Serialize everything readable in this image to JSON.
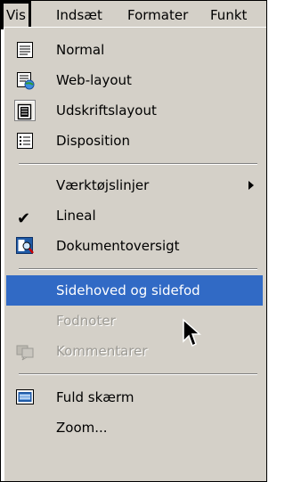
{
  "menubar": {
    "items": [
      "Vis",
      "Indsæt",
      "Formater",
      "Funkt"
    ]
  },
  "menu": {
    "items": [
      {
        "label": "Normal",
        "icon": "normal-view-icon"
      },
      {
        "label": "Web-layout",
        "icon": "web-layout-icon"
      },
      {
        "label": "Udskriftslayout",
        "icon": "print-layout-icon",
        "selected": true
      },
      {
        "label": "Disposition",
        "icon": "outline-icon"
      },
      {
        "label": "Værktøjslinjer",
        "submenu": true
      },
      {
        "label": "Lineal",
        "checked": true,
        "icon": "checkmark-icon"
      },
      {
        "label": "Dokumentoversigt",
        "icon": "document-map-icon"
      },
      {
        "label": "Sidehoved og sidefod",
        "highlighted": true
      },
      {
        "label": "Fodnoter",
        "disabled": true
      },
      {
        "label": "Kommentarer",
        "disabled": true,
        "icon": "comments-icon"
      },
      {
        "label": "Fuld skærm",
        "icon": "full-screen-icon"
      },
      {
        "label": "Zoom..."
      }
    ]
  },
  "colors": {
    "menu_bg": "#d4d0c8",
    "highlight": "#316ac5",
    "disabled_text": "#9c9a94"
  }
}
